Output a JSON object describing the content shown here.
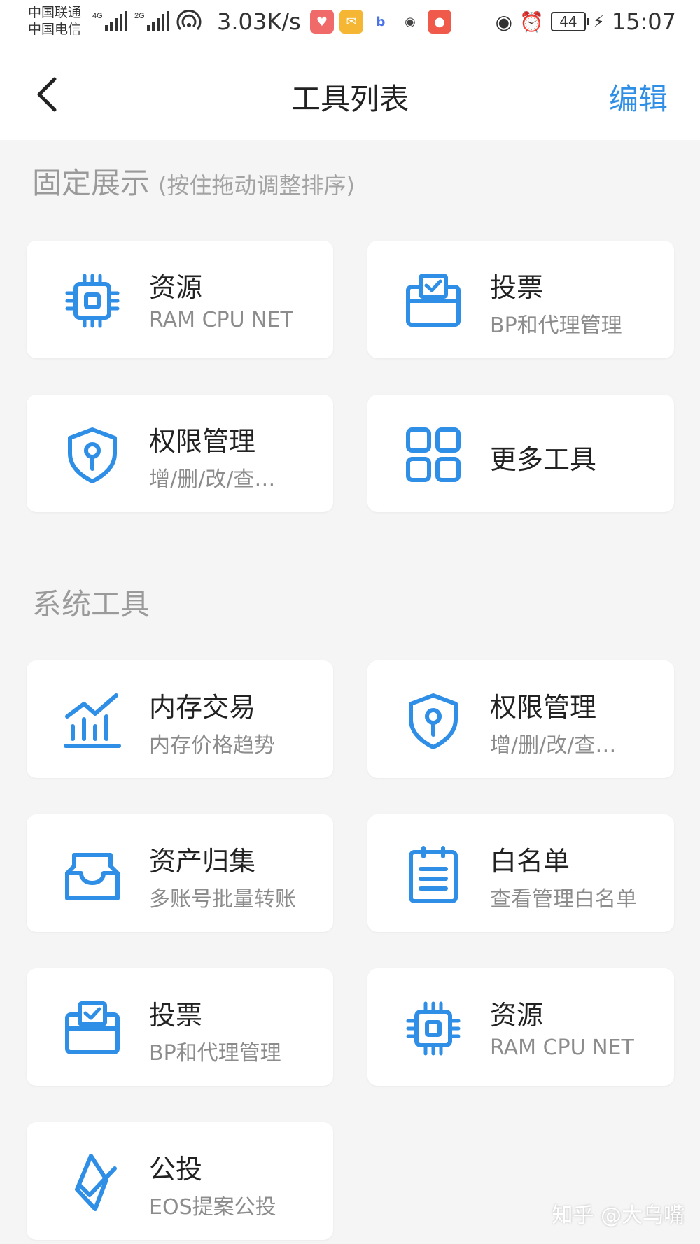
{
  "status": {
    "carrier1": "中国联通",
    "carrier2": "中国电信",
    "net1": "4G",
    "net2": "2G",
    "speed": "3.03K/s",
    "battery": "44",
    "time": "15:07",
    "app_icons": [
      "heart-app-icon",
      "mail-app-icon",
      "b-app-icon",
      "wechat-icon",
      "red-app-icon"
    ]
  },
  "nav": {
    "title": "工具列表",
    "edit": "编辑"
  },
  "fixed": {
    "title": "固定展示",
    "hint": "(按住拖动调整排序)",
    "items": [
      {
        "name": "资源",
        "desc": "RAM CPU NET",
        "icon": "chip-icon"
      },
      {
        "name": "投票",
        "desc": "BP和代理管理",
        "icon": "ballot-box-icon"
      },
      {
        "name": "权限管理",
        "desc": "增/删/改/查…",
        "icon": "shield-key-icon"
      },
      {
        "name": "更多工具",
        "desc": "",
        "icon": "grid-icon"
      }
    ]
  },
  "system": {
    "title": "系统工具",
    "items": [
      {
        "name": "内存交易",
        "desc": "内存价格趋势",
        "icon": "chart-trend-icon"
      },
      {
        "name": "权限管理",
        "desc": "增/删/改/查…",
        "icon": "shield-key-icon"
      },
      {
        "name": "资产归集",
        "desc": "多账号批量转账",
        "icon": "inbox-icon"
      },
      {
        "name": "白名单",
        "desc": "查看管理白名单",
        "icon": "clipboard-list-icon"
      },
      {
        "name": "投票",
        "desc": "BP和代理管理",
        "icon": "ballot-box-icon"
      },
      {
        "name": "资源",
        "desc": "RAM CPU NET",
        "icon": "chip-icon"
      },
      {
        "name": "公投",
        "desc": "EOS提案公投",
        "icon": "eos-check-icon"
      }
    ]
  },
  "watermark": "知乎 @大乌嘴",
  "colors": {
    "accent": "#2f8ee6",
    "background": "#f5f5f5"
  }
}
